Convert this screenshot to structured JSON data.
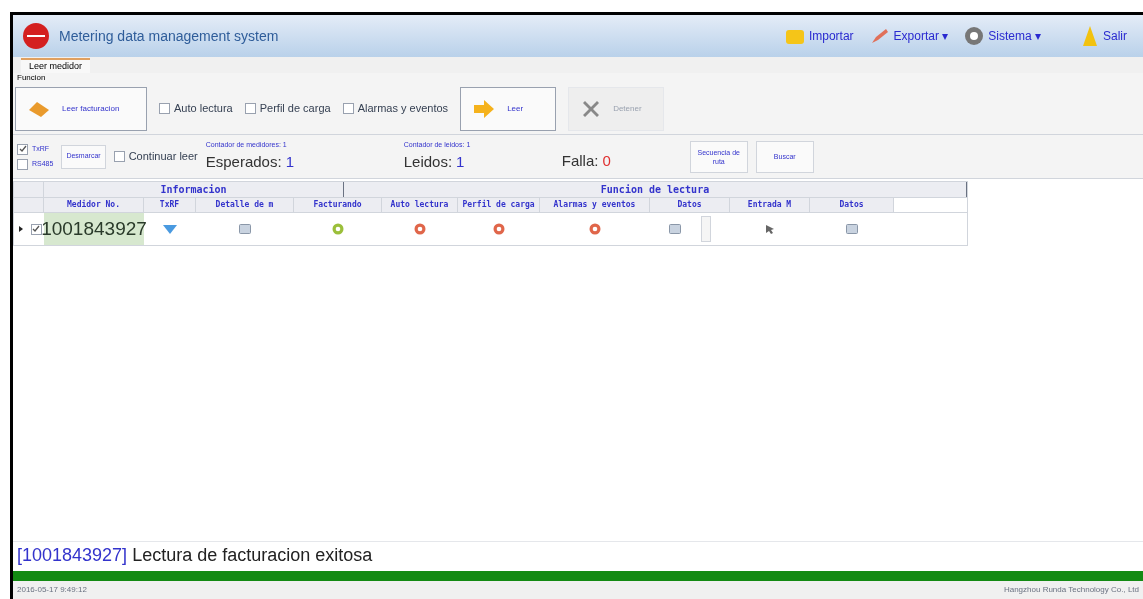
{
  "window": {
    "title": "Metering data management system"
  },
  "menu": [
    {
      "label": "Importar",
      "kind": "import"
    },
    {
      "label": "Exportar ▾",
      "kind": "export"
    },
    {
      "label": "Sistema ▾",
      "kind": "system"
    },
    {
      "label": "Salir",
      "kind": "exit"
    }
  ],
  "tabs": [
    {
      "label": "Leer medidor",
      "selected": true
    }
  ],
  "group_label": "Funcion",
  "toolbar": [
    {
      "kind": "button",
      "label": "Leer facturacion",
      "disabled": false
    },
    {
      "kind": "checkbox",
      "label": "Auto lectura",
      "checked": false
    },
    {
      "kind": "checkbox",
      "label": "Perfil de carga",
      "checked": false
    },
    {
      "kind": "checkbox",
      "label": "Alarmas y eventos",
      "checked": false
    },
    {
      "kind": "button",
      "label": "Leer",
      "disabled": false
    },
    {
      "kind": "button",
      "label": "Detener",
      "disabled": true
    }
  ],
  "channels": [
    {
      "label": "TxRF",
      "checked": true
    },
    {
      "label": "RS485",
      "checked": false
    }
  ],
  "uncheck_button": "Desmarcar",
  "continue": {
    "label": "Continuar leer",
    "checked": false
  },
  "counters": [
    {
      "caption": "Contador de medidores: 1",
      "label": "Esperados:",
      "value": "1",
      "kind": "normal"
    },
    {
      "caption": "Contador de leidos: 1",
      "label": "Leidos:",
      "value": "1",
      "kind": "normal"
    },
    {
      "label": "Falla:",
      "value": "0",
      "kind": "fail"
    }
  ],
  "actions": [
    "Secuencia de ruta",
    "Buscar"
  ],
  "table": {
    "groups": [
      {
        "label": "Informacion"
      },
      {
        "label": "Funcion de lectura"
      }
    ],
    "columns": [
      "Medidor No.",
      "TxRF",
      "Detalle de m",
      "Facturando",
      "Auto lectura",
      "Perfil de carga",
      "Alarmas y eventos",
      "Datos",
      "Entrada M",
      "Datos"
    ],
    "rows": [
      {
        "checked": true,
        "meter": "1001843927",
        "status": [
          {
            "success": true
          },
          {
            "success": false
          },
          {
            "success": false
          },
          {
            "success": false
          }
        ]
      }
    ]
  },
  "message": {
    "id": "[1001843927]",
    "text": "Lectura de facturacion exitosa"
  },
  "progress": {
    "level": 1
  },
  "status_bar": {
    "time": "2016-05-17 9:49:12",
    "company": "Hangzhou Runda Technology Co., Ltd"
  }
}
